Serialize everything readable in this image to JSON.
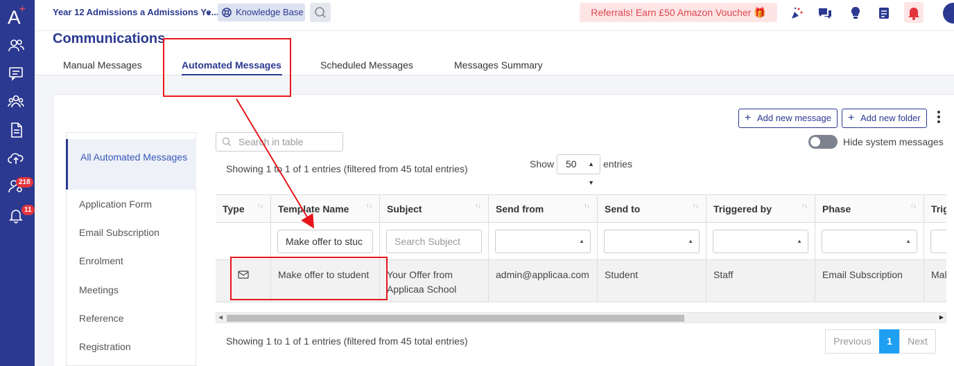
{
  "app": {
    "logo_text": "A",
    "logo_plus": "+"
  },
  "sidebar": {
    "items": [
      {
        "icon": "users-icon"
      },
      {
        "icon": "chat-icon"
      },
      {
        "icon": "group-icon"
      },
      {
        "icon": "document-icon"
      },
      {
        "icon": "cloud-upload-icon"
      },
      {
        "icon": "user-settings-icon",
        "badge": "218"
      },
      {
        "icon": "bell-icon",
        "badge": "11"
      }
    ]
  },
  "topbar": {
    "title": "Year 12 Admissions a Admissions Ye...",
    "knowledge_base": "Knowledge Base",
    "referral": "Referrals! Earn £50 Amazon Voucher 🎁"
  },
  "page": {
    "title": "Communications"
  },
  "tabs": [
    {
      "label": "Manual Messages"
    },
    {
      "label": "Automated Messages",
      "active": true
    },
    {
      "label": "Scheduled Messages"
    },
    {
      "label": "Messages Summary"
    }
  ],
  "left_nav": {
    "active": "All Automated Messages",
    "items": [
      "Application Form",
      "Email Subscription",
      "Enrolment",
      "Meetings",
      "Reference",
      "Registration"
    ]
  },
  "toolbar": {
    "search_placeholder": "Search in table",
    "info_top": "Showing 1 to 1 of 1 entries (filtered from 45 total entries)",
    "show_label": "Show",
    "show_value": "50",
    "entries_label": "entries",
    "add_message": "Add new message",
    "add_folder": "Add new folder",
    "hide_system": "Hide system messages"
  },
  "table": {
    "columns": [
      "Type",
      "Template Name",
      "Subject",
      "Send from",
      "Send to",
      "Triggered by",
      "Phase",
      "Trig"
    ],
    "filters": {
      "template_name": "Make offer to stuc",
      "subject_placeholder": "Search Subject"
    },
    "rows": [
      {
        "type_icon": "envelope-icon",
        "template_name": "Make offer to student",
        "subject": "Your Offer from Applicaa School",
        "send_from": "admin@applicaa.com",
        "send_to": "Student",
        "triggered_by": "Staff",
        "phase": "Email Subscription",
        "trig": "Mal"
      }
    ]
  },
  "footer": {
    "info_bottom": "Showing 1 to 1 of 1 entries (filtered from 45 total entries)",
    "previous": "Previous",
    "page": "1",
    "next": "Next"
  },
  "colors": {
    "brand": "#2b3990",
    "annotation": "#e8161b",
    "pager_active": "#1e9ff2"
  }
}
